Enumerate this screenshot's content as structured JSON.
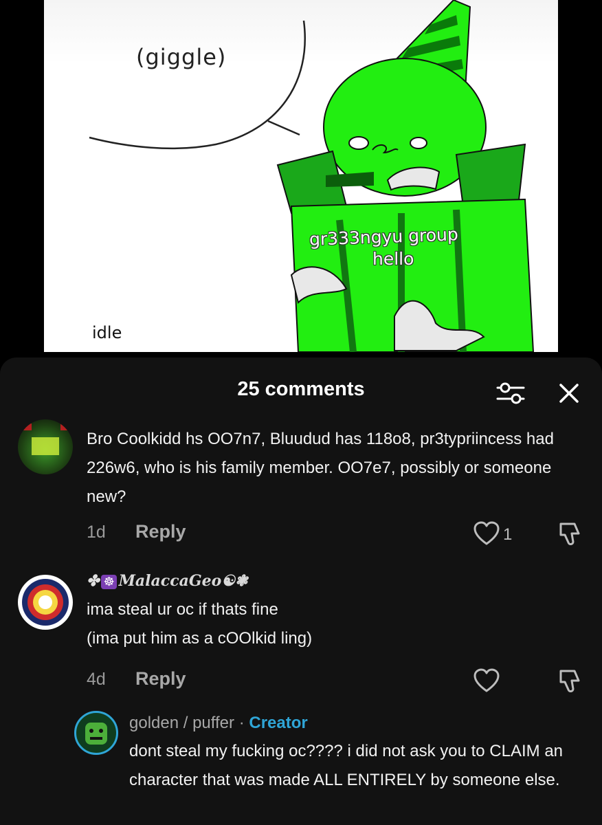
{
  "video": {
    "speech_text": "(giggle)",
    "corner_label": "idle",
    "caption_line1": "gr333ngyu group",
    "caption_line2": "hello"
  },
  "comments_sheet": {
    "count_label": "25 comments",
    "filter_icon": "sliders-icon",
    "close_icon": "close-icon",
    "comments": [
      {
        "username": "",
        "text": "Bro Coolkidd hs OO7n7, Bluudud has 118o8, pr3typriincess had 226w6, who is his family member. OO7e7, possibly or someone new?",
        "age": "1d",
        "reply_label": "Reply",
        "likes": "1"
      },
      {
        "username": "MalaccaGeo",
        "text_line1": "ima steal ur oc if thats fine",
        "text_line2": "(ima put him as a cOOlkid ling)",
        "age": "4d",
        "reply_label": "Reply",
        "likes": ""
      },
      {
        "username": "golden / puffer",
        "separator": "·",
        "badge": "Creator",
        "text": "dont steal my fucking oc???? i did not ask you to CLAIM an character that was made ALL ENTIRELY by someone else."
      }
    ]
  },
  "colors": {
    "sheet_bg": "#121212",
    "creator_badge": "#2fa5d6",
    "oc_green": "#22ee11"
  }
}
